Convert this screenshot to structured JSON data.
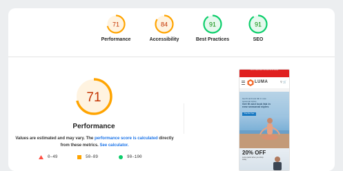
{
  "gauges": [
    {
      "score": "71",
      "label": "Performance",
      "value": 71,
      "color": "#ffa400",
      "fill": "#fff3e0"
    },
    {
      "score": "84",
      "label": "Accessibility",
      "value": 84,
      "color": "#ffa400",
      "fill": "#fff3e0"
    },
    {
      "score": "91",
      "label": "Best Practices",
      "value": 91,
      "color": "#0cce6b",
      "fill": "#e6f9ee"
    },
    {
      "score": "91",
      "label": "SEO",
      "value": 91,
      "color": "#0cce6b",
      "fill": "#e6f9ee"
    }
  ],
  "performance": {
    "score": "71",
    "value": 71,
    "title": "Performance",
    "desc_part1": "Values are estimated and may vary. The ",
    "desc_link1": "performance score is calculated",
    "desc_part2": " directly from these metrics. ",
    "desc_link2": "See calculator."
  },
  "legend": [
    {
      "range": "0–49",
      "shape": "triangle-icon",
      "color": "#ff4e42"
    },
    {
      "range": "50–89",
      "shape": "square-icon",
      "color": "#ffa400"
    },
    {
      "range": "90–100",
      "shape": "circle-icon",
      "color": "#0cce6b"
    }
  ],
  "screenshot": {
    "banner": "This is a demo store. No orders will be fulfilled.",
    "brand": "LUMA",
    "hero_line1": "Get fit and look fab in",
    "hero_line2": "new seasonal styles",
    "hero_small": "Get fit and look fab in new seasonal styles",
    "hero_button": "Shop New Yoga",
    "promo_title": "20% OFF",
    "promo_sub": "Luma pants when you shop today"
  }
}
